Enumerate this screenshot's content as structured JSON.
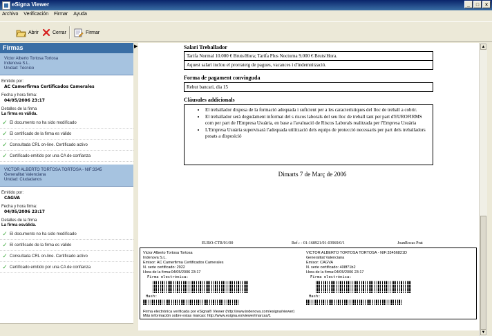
{
  "window": {
    "title": "eSigna Viewer"
  },
  "menu": [
    "Archivo",
    "Verificación",
    "Firmar",
    "Ayuda"
  ],
  "toolbar": {
    "open": "Abrir",
    "close": "Cerrar",
    "sign": "Firmar"
  },
  "panel": {
    "title": "Firmas",
    "signatures": [
      {
        "name": "Victor Alberto Tortosa Tortosa",
        "org": "Indenova S.L.",
        "unit": "Unidad: Técnico",
        "issuer_label": "Emitido por:",
        "issuer": "AC Camerfirma Certificados Camerales",
        "date_label": "Fecha y hora firma:",
        "date": "04/05/2006 23:17",
        "details_label": "Detalles de la firma",
        "status": "La firma es válida.",
        "checks": [
          "El documento no ha sido modificado",
          "El certificado de la firma es válido",
          "Consultada CRL on-line. Certificado activo",
          "Certificado emitido por una CA de confianza"
        ]
      },
      {
        "name": "VICTOR ALBERTO TORTOSA TORTOSA - NIF:3345",
        "org": "Generalitat Valenciana",
        "unit": "Unidad: Ciudadanos",
        "issuer_label": "Emitido por:",
        "issuer": "CAGVA",
        "date_label": "Fecha y hora firma:",
        "date": "04/05/2006 23:17",
        "details_label": "Detalles de la firma",
        "status": "La firma esválida.",
        "checks": [
          "El documento no ha sido modificado",
          "El certificado de la firma es válido",
          "Consultada CRL on-line. Certificado activo",
          "Certificado emitido por una CA de confianza"
        ]
      }
    ]
  },
  "document": {
    "salary": {
      "heading": "Salari Treballador",
      "line1": "Tarifa Normal 10.000 € Bruts/Hora; Tarifa Plus Nocturna 9.000 € Bruts/Hora.",
      "line2": "Aquest salari inclou el prorrateig de pagues, vacances i d'indemnització."
    },
    "payment": {
      "heading": "Forma de pagament convinguda",
      "line1": "Rebut bancari, dia 15"
    },
    "clauses": {
      "heading": "Clàusules addicionals",
      "items": [
        "El treballador disposa de la formació adequada i suficient per a les característiques del lloc de treball a cobrir.",
        "El treballador serà degudament informat del s riscos laborals del seu lloc de treball tant per part d'EUROFIRMS com per part de l'Empresa Usuària, en base a l'avaluació de Riscos Laborals realitzada per l'Empresa Usuària",
        "L'Empresa Usuària supervisarà l'adequada utilització dels equips de protecció necessaris per part dels treballadors posats a disposició"
      ]
    },
    "date": "Dimarts 7 de Març de 2006",
    "footer": {
      "code": "EURO-CTR/01/00",
      "ref": "Ref.: - 01-168921/01-03969/0/1",
      "name": "JoanRocas Prat"
    },
    "stamp": {
      "left": {
        "name": "Victor Alberto Tortosa Tortosa",
        "org": "Indenova S.L.",
        "issuer": "Emisor: AC Camerfirma Certificados Camerales",
        "serial": "N. serie certificado: 2922",
        "time": "Hora de la firma:04/05/2006 23:17",
        "sig_label": "Firma electrónica:",
        "hash_label": "Hash:"
      },
      "right": {
        "name": "VICTOR ALBERTO TORTOSA TORTOSA - NIF:33456821D",
        "org": "Generalitat Valenciana",
        "issuer": "Emisor: CAGVA",
        "serial": "N. serie certificado: 408f71b2",
        "time": "Hora de la firma:04/05/2006 23:17",
        "sig_label": "Firma electrónica:",
        "hash_label": "Hash:"
      },
      "note1": "Firma electrónica verificada por eSigna® Viewer (http://www.indenova.com/esigna/viewer)",
      "note2": "Más información sobre estas marcas: http://www.esigna.es/viewer/marcas/1"
    }
  }
}
